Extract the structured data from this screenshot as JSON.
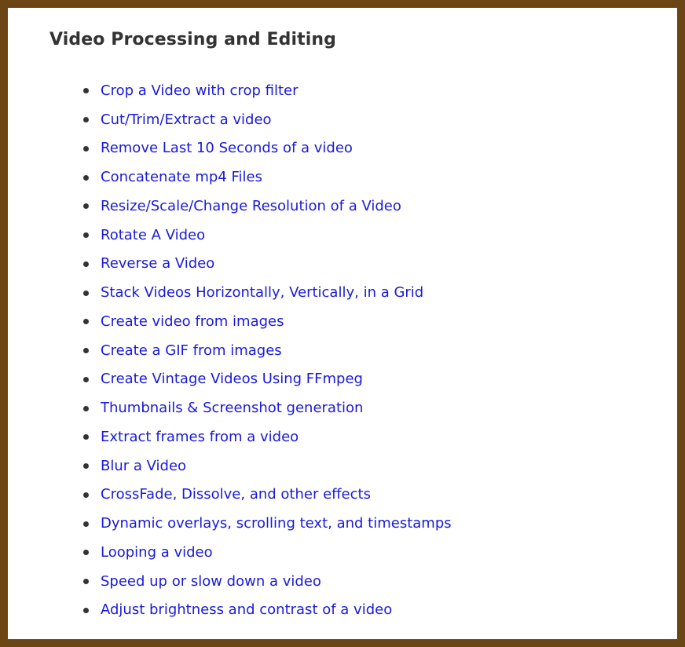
{
  "section": {
    "title": "Video Processing and Editing"
  },
  "links": [
    "Crop a Video with crop filter",
    "Cut/Trim/Extract a video",
    "Remove Last 10 Seconds of a video",
    "Concatenate mp4 Files",
    "Resize/Scale/Change Resolution of a Video",
    "Rotate A Video",
    "Reverse a Video",
    "Stack Videos Horizontally, Vertically, in a Grid",
    "Create video from images",
    "Create a GIF from images",
    "Create Vintage Videos Using FFmpeg",
    "Thumbnails & Screenshot generation",
    "Extract frames from a video",
    "Blur a Video",
    "CrossFade, Dissolve, and other effects",
    "Dynamic overlays, scrolling text, and timestamps",
    "Looping a video",
    "Speed up or slow down a video",
    "Adjust brightness and contrast of a video"
  ],
  "colors": {
    "border": "#6b4513",
    "background": "#ffffff",
    "title": "#333333",
    "link": "#1a1adb",
    "bullet": "#333333"
  }
}
